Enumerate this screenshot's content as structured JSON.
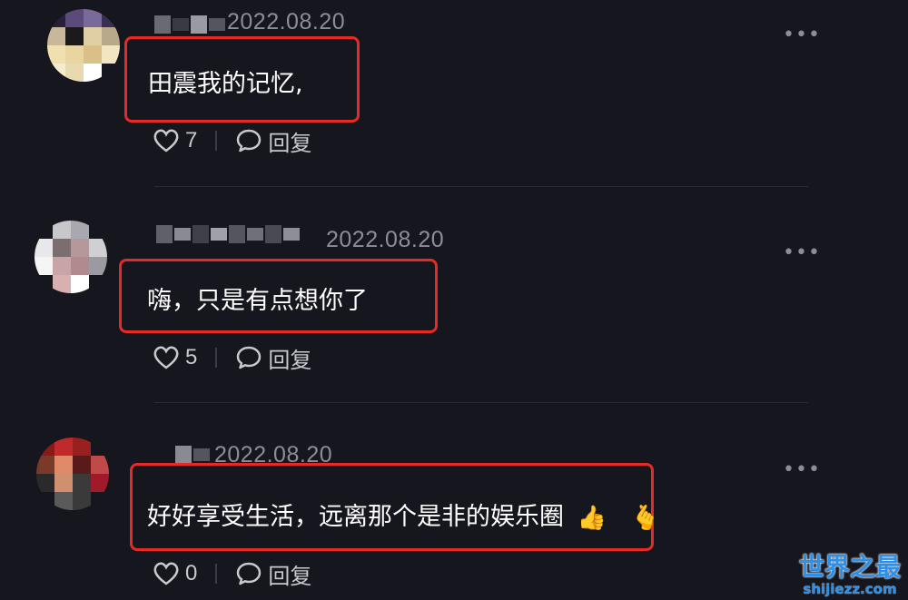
{
  "comments": [
    {
      "date": "2022.08.20",
      "text": "田震我的记忆,",
      "likes": "7",
      "reply_label": "回复",
      "more_label": "•••",
      "avatar_colors": [
        "#2a1f3a",
        "#5c4a7a",
        "#7a6a9a",
        "#3a2f52",
        "#c9b79a",
        "#1a1a1a",
        "#e0cfa5",
        "#b7a98a",
        "#f0e0b0",
        "#e8d5a0",
        "#d9c089",
        "#f2e6c2",
        "#f5ecd0",
        "#e9d9b0",
        "#ffffff",
        "#16161e"
      ],
      "username_colors": [
        "#6a6a72",
        "#3a3a42",
        "#9a9aa2",
        "#555560"
      ]
    },
    {
      "date": "2022.08.20",
      "text": "嗨，只是有点想你了",
      "likes": "5",
      "reply_label": "回复",
      "more_label": "•••",
      "avatar_colors": [
        "#16161e",
        "#c8c8cc",
        "#a8a8ae",
        "#16161e",
        "#e8e8ea",
        "#7a6e70",
        "#b4989a",
        "#d0d0d4",
        "#f5f5f5",
        "#c9a4a6",
        "#b08a8c",
        "#9a9aa0",
        "#16161e",
        "#d8b0b2",
        "#ffffff",
        "#16161e"
      ],
      "username_colors": [
        "#606068",
        "#8a8a92",
        "#404048",
        "#a0a0a8",
        "#555560",
        "#707078",
        "#4a4a52",
        "#8e8e96"
      ]
    },
    {
      "date": "2022.08.20",
      "text": "好好享受生活，远离那个是非的娱乐圈",
      "likes": "0",
      "reply_label": "回复",
      "more_label": "•••",
      "emoji_1": "👍",
      "emoji_2": "🫰",
      "avatar_colors": [
        "#8a1a1a",
        "#c02a2a",
        "#9a1f1f",
        "#16161e",
        "#7a3a2a",
        "#e08a6a",
        "#5a1a1a",
        "#c04a4a",
        "#2a2a2a",
        "#d09070",
        "#3a3a3a",
        "#a01a2a",
        "#16161e",
        "#5a5a5a",
        "#3a3a3a",
        "#16161e"
      ],
      "username_colors": [
        "#8a8a92",
        "#555560"
      ]
    }
  ],
  "watermark": {
    "title": "世界之最",
    "subtitle": "shijiezz.com"
  },
  "colors": {
    "background": "#16161e",
    "highlight_border": "#e62a26",
    "secondary_text": "#8d8d96",
    "watermark": "#2e8fe6"
  },
  "icons": {
    "like": "heart-outline-icon",
    "reply": "speech-bubble-icon",
    "more": "more-dots-icon"
  }
}
